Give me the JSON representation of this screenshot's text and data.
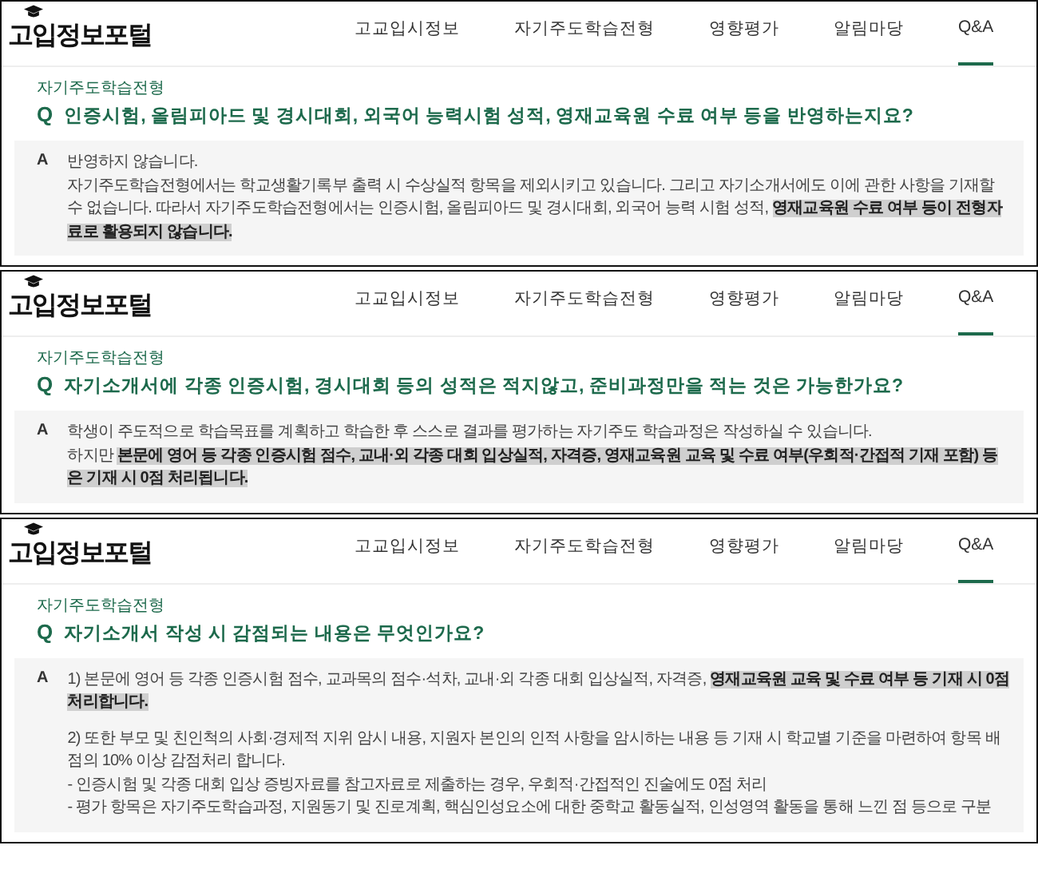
{
  "panels": [
    {
      "logo": "고입정보포털",
      "nav": [
        {
          "label": "고교입시정보",
          "selected": false
        },
        {
          "label": "자기주도학습전형",
          "selected": false
        },
        {
          "label": "영향평가",
          "selected": false
        },
        {
          "label": "알림마당",
          "selected": false
        },
        {
          "label": "Q&A",
          "selected": true
        }
      ],
      "category": "자기주도학습전형",
      "question_mark": "Q",
      "question": "인증시험, 올림피아드 및 경시대회, 외국어 능력시험 성적, 영재교육원 수료 여부 등을 반영하는지요?",
      "answer_mark": "A",
      "answer_blocks": [
        {
          "lines": [
            {
              "segments": [
                {
                  "text": "반영하지 않습니다.",
                  "highlight": false
                }
              ]
            },
            {
              "segments": [
                {
                  "text": "자기주도학습전형에서는 학교생활기록부 출력 시 수상실적 항목을 제외시키고 있습니다. 그리고 자기소개서에도 이에 관한 사항을 기재할 수 없습니다. 따라서 자기주도학습전형에서는 인증시험, 올림피아드 및 경시대회, 외국어 능력 시험 성적, ",
                  "highlight": false
                },
                {
                  "text": "영재교육원 수료 여부 등이 전형자료로 활용되지 않습니다.",
                  "highlight": true
                }
              ]
            }
          ]
        }
      ]
    },
    {
      "logo": "고입정보포털",
      "nav": [
        {
          "label": "고교입시정보",
          "selected": false
        },
        {
          "label": "자기주도학습전형",
          "selected": false
        },
        {
          "label": "영향평가",
          "selected": false
        },
        {
          "label": "알림마당",
          "selected": false
        },
        {
          "label": "Q&A",
          "selected": true
        }
      ],
      "category": "자기주도학습전형",
      "question_mark": "Q",
      "question": "자기소개서에 각종 인증시험, 경시대회 등의 성적은 적지않고, 준비과정만을 적는 것은 가능한가요?",
      "answer_mark": "A",
      "answer_blocks": [
        {
          "lines": [
            {
              "segments": [
                {
                  "text": "학생이 주도적으로 학습목표를 계획하고 학습한 후 스스로 결과를 평가하는 자기주도 학습과정은 작성하실 수 있습니다.",
                  "highlight": false
                }
              ]
            },
            {
              "segments": [
                {
                  "text": "하지만 ",
                  "highlight": false
                },
                {
                  "text": "본문에 영어 등 각종 인증시험 점수, 교내·외 각종 대회 입상실적, 자격증, 영재교육원 교육 및 수료 여부(우회적·간접적 기재 포함) 등은 기재 시 0점 처리됩니다.",
                  "highlight": true
                }
              ]
            }
          ]
        }
      ]
    },
    {
      "logo": "고입정보포털",
      "nav": [
        {
          "label": "고교입시정보",
          "selected": false
        },
        {
          "label": "자기주도학습전형",
          "selected": false
        },
        {
          "label": "영향평가",
          "selected": false
        },
        {
          "label": "알림마당",
          "selected": false
        },
        {
          "label": "Q&A",
          "selected": true
        }
      ],
      "category": "자기주도학습전형",
      "question_mark": "Q",
      "question": "자기소개서 작성 시 감점되는 내용은 무엇인가요?",
      "answer_mark": "A",
      "answer_blocks": [
        {
          "lines": [
            {
              "segments": [
                {
                  "text": "1) 본문에 영어 등 각종 인증시험 점수, 교과목의 점수·석차, 교내·외 각종 대회 입상실적, 자격증, ",
                  "highlight": false
                },
                {
                  "text": "영재교육원 교육 및 수료 여부 등 기재 시 0점 처리합니다.",
                  "highlight": true
                }
              ]
            }
          ]
        },
        {
          "lines": [
            {
              "segments": [
                {
                  "text": "2) 또한 부모 및 친인척의 사회·경제적 지위 암시 내용, 지원자 본인의 인적 사항을 암시하는 내용 등 기재 시 학교별 기준을 마련하여 항목 배점의 10% 이상 감점처리 합니다.",
                  "highlight": false
                }
              ]
            },
            {
              "segments": [
                {
                  "text": "- 인증시험 및 각종 대회 입상 증빙자료를 참고자료로 제출하는 경우, 우회적·간접적인 진술에도 0점 처리",
                  "highlight": false
                }
              ]
            },
            {
              "segments": [
                {
                  "text": "- 평가 항목은 자기주도학습과정, 지원동기 및 진로계획, 핵심인성요소에 대한 중학교 활동실적, 인성영역 활동을 통해 느낀 점 등으로 구분",
                  "highlight": false
                }
              ]
            }
          ]
        }
      ]
    }
  ]
}
